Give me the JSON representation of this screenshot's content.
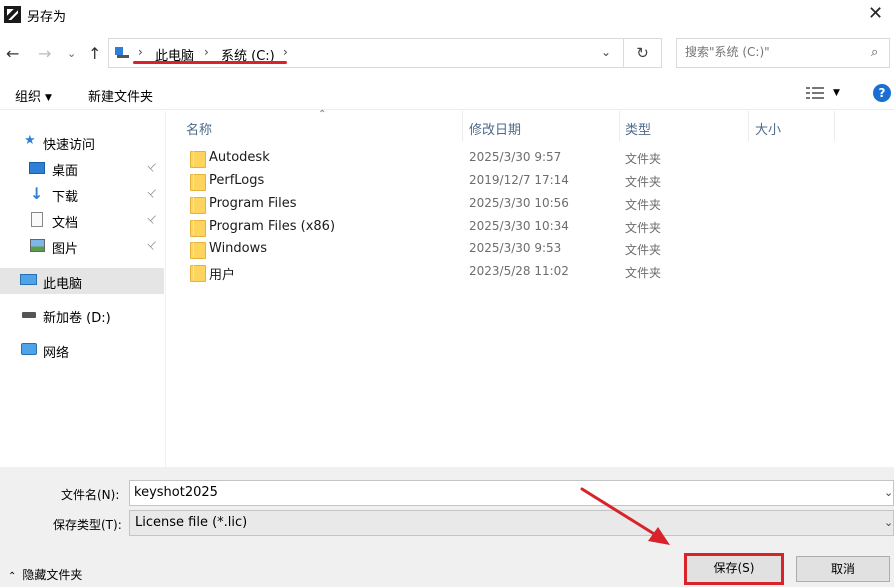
{
  "window": {
    "title": "另存为",
    "close_glyph": "✕"
  },
  "nav": {
    "back_glyph": "←",
    "forward_glyph": "→",
    "recent_glyph": "⌄",
    "up_glyph": "↑",
    "breadcrumb": [
      "此电脑",
      "系统 (C:)"
    ],
    "crumb_sep": "›",
    "dropdown_glyph": "⌄",
    "refresh_glyph": "↻",
    "search_placeholder": "搜索\"系统 (C:)\"",
    "search_glyph": "⌕"
  },
  "toolbar": {
    "organize_label": "组织",
    "caret": "▼",
    "new_folder_label": "新建文件夹",
    "help_glyph": "?"
  },
  "sidebar": {
    "quick_access": "快速访问",
    "items": [
      {
        "label": "桌面",
        "pinned": true
      },
      {
        "label": "下载",
        "pinned": true
      },
      {
        "label": "文档",
        "pinned": true
      },
      {
        "label": "图片",
        "pinned": true
      }
    ],
    "pin_glyph": "📌",
    "this_pc": "此电脑",
    "drive_d": "新加卷 (D:)",
    "network": "网络"
  },
  "columns": {
    "name": "名称",
    "modified": "修改日期",
    "type": "类型",
    "size": "大小",
    "sort_glyph": "⌃"
  },
  "files": [
    {
      "name": "Autodesk",
      "modified": "2025/3/30 9:57",
      "type": "文件夹"
    },
    {
      "name": "PerfLogs",
      "modified": "2019/12/7 17:14",
      "type": "文件夹"
    },
    {
      "name": "Program Files",
      "modified": "2025/3/30 10:56",
      "type": "文件夹"
    },
    {
      "name": "Program Files (x86)",
      "modified": "2025/3/30 10:34",
      "type": "文件夹"
    },
    {
      "name": "Windows",
      "modified": "2025/3/30 9:53",
      "type": "文件夹"
    },
    {
      "name": "用户",
      "modified": "2023/5/28 11:02",
      "type": "文件夹"
    }
  ],
  "bottom": {
    "filename_label": "文件名(N):",
    "filename_value": "keyshot2025",
    "filetype_label": "保存类型(T):",
    "filetype_value": "License file (*.lic)",
    "field_caret": "⌄",
    "hide_folders_caret": "⌃",
    "hide_folders_label": "隐藏文件夹",
    "save_label": "保存(S)",
    "cancel_label": "取消"
  },
  "colors": {
    "accent": "#0078d7",
    "highlight": "#d8232a",
    "selected_row": "#e5e5e5",
    "folder": "#ffd45e"
  }
}
